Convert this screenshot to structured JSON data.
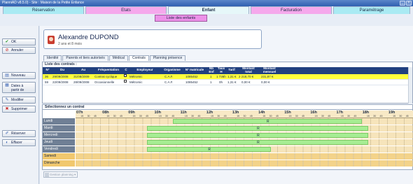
{
  "window": {
    "title": "PlanniAD v8.5.0) - Site : Maison de la Petite Enfance",
    "min": "_",
    "close": "×"
  },
  "tabs": [
    {
      "label": "Réservation",
      "color": "#a9eaf3"
    },
    {
      "label": "Etats",
      "color": "#f5a9ec"
    },
    {
      "label": "Enfant",
      "color": "#e6f7f9"
    },
    {
      "label": "Facturation",
      "color": "#f5a9ec"
    },
    {
      "label": "Paramétrage",
      "color": "#a9eaf3"
    }
  ],
  "subtab": "Liste des enfants",
  "sidebar": {
    "ok": "OK",
    "annuler": "Annuler",
    "nouveau": "Nouveau",
    "dates_1": "Dates à",
    "dates_2": "partir de",
    "modifier": "Modifier",
    "supprimer": "Supprimer",
    "reserver": "Réserver",
    "effacer": "Effacer"
  },
  "child": {
    "name": "Alexandre DUPOND",
    "age": "2 ans et 8 mois"
  },
  "child_tabs": [
    "Identité",
    "Parents et tiers autorisés",
    "Médical",
    "Contrats",
    "Planning présence"
  ],
  "contacts": {
    "title": "Liste des contrats :",
    "headers": [
      "N°",
      "Du",
      "Au",
      "Fréquentation",
      "C",
      "Employeur",
      "Organisme",
      "N° matricule",
      "Nb Enf",
      "Taux H",
      "Tarif",
      "Montant total",
      "Montant mensuel"
    ],
    "rows": [
      {
        "n": "36",
        "du": "29/09/2008",
        "au": "31/08/2009",
        "freq": "Contrat cyclique",
        "emp": "Métromic",
        "org": "C.A.F.",
        "mat": "1085452",
        "nb": "1",
        "taux": "1 736h",
        "tarif": "1,31 €",
        "total": "2 218,70 €",
        "mensuel": "231,87 €"
      },
      {
        "n": "59",
        "du": "22/09/2008",
        "au": "28/09/2008",
        "freq": "Occasionnelle",
        "emp": "Métromic",
        "org": "C.A.F.",
        "mat": "1085452",
        "nb": "1",
        "taux": "0h",
        "tarif": "1,31 €",
        "total": "0,00 €",
        "mensuel": "0,00 €"
      }
    ]
  },
  "planning": {
    "title": "Sélectionnez un contrat",
    "hours": [
      "07h",
      "08h",
      "09h",
      "10h",
      "11h",
      "12h",
      "13h",
      "14h",
      "15h",
      "16h",
      "17h",
      "18h",
      "19h"
    ],
    "quarters": [
      "15",
      "30",
      "45"
    ],
    "days": [
      {
        "name": "Lundi",
        "start": 10.75,
        "end": 18.0,
        "mark": "R"
      },
      {
        "name": "Mardi",
        "start": 9.75,
        "end": 18.25,
        "mark": "R"
      },
      {
        "name": "Mercredi",
        "start": 9.75,
        "end": 18.25,
        "mark": "R"
      },
      {
        "name": "Jeudi",
        "start": 9.75,
        "end": 18.25,
        "mark": "R"
      },
      {
        "name": "Vendredi",
        "start": 9.75,
        "end": 14.5,
        "mark": "R"
      },
      {
        "name": "Samedi",
        "weekend": true
      },
      {
        "name": "Dimanche",
        "weekend": true
      }
    ],
    "button": "Gestion planning"
  }
}
